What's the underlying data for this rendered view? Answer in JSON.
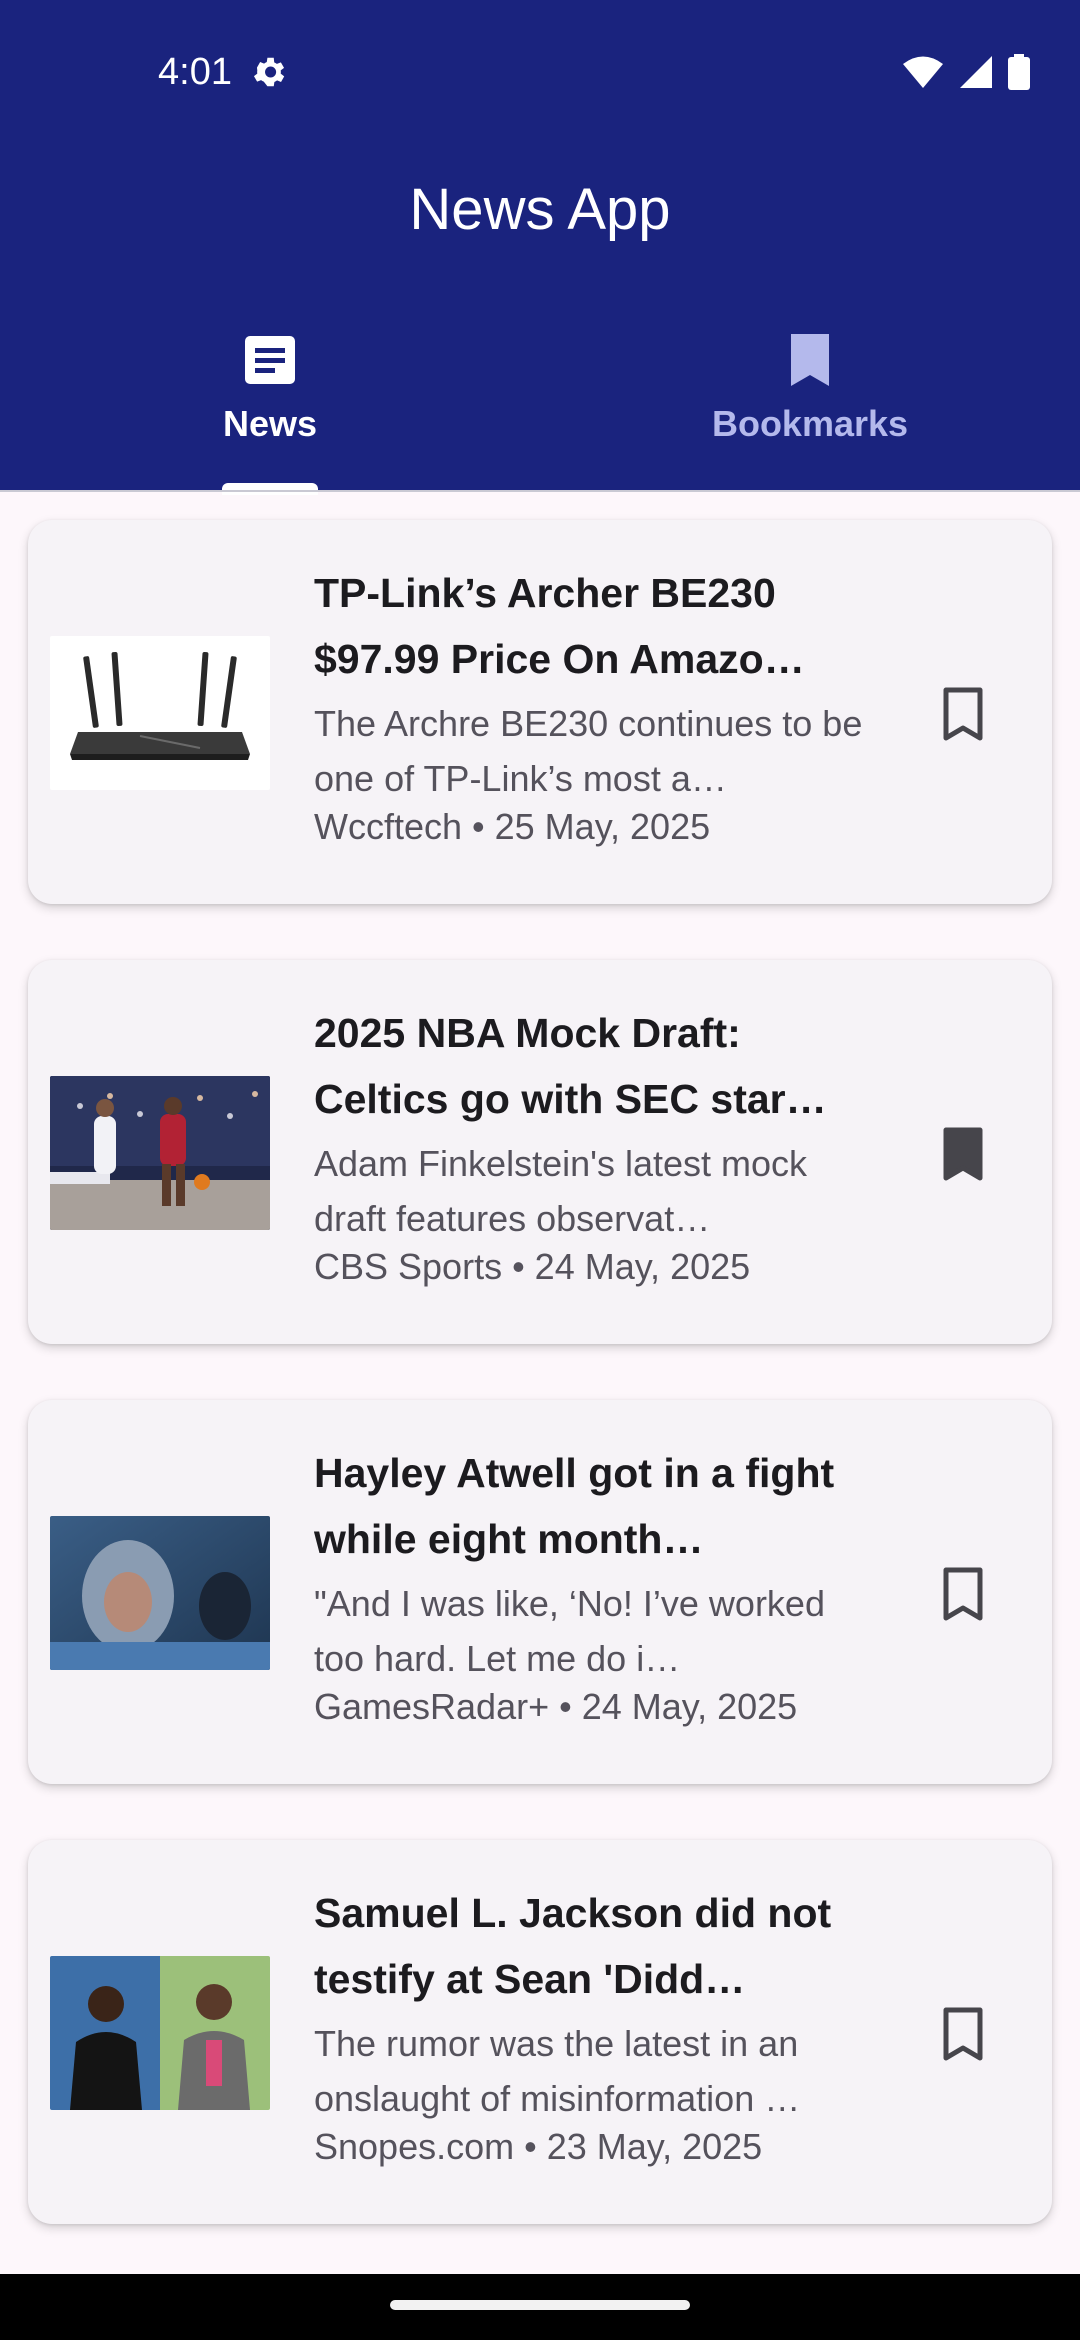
{
  "status_bar": {
    "time": "4:01",
    "icons": [
      "settings-gear-icon",
      "wifi-icon",
      "cellular-signal-icon",
      "battery-icon"
    ]
  },
  "app_bar": {
    "title": "News App",
    "background_color": "#1a237e"
  },
  "tabs": [
    {
      "label": "News",
      "icon": "article-icon",
      "selected": true
    },
    {
      "label": "Bookmarks",
      "icon": "bookmark-icon",
      "selected": false
    }
  ],
  "articles": [
    {
      "headline": "TP-Link’s Archer BE230 $97.99 Price On Amazo…",
      "description": "The Archre BE230 continues to be one of TP-Link’s most a…",
      "meta": "Wccftech • 25 May, 2025",
      "bookmarked": false,
      "thumbnail": "wifi-router-image"
    },
    {
      "headline": "2025 NBA Mock Draft: Celtics go with SEC star…",
      "description": "Adam Finkelstein's latest mock draft features observat…",
      "meta": "CBS Sports • 24 May, 2025",
      "bookmarked": true,
      "thumbnail": "basketball-game-image"
    },
    {
      "headline": "Hayley Atwell got in a fight while eight month…",
      "description": "\"And I was like, ‘No! I’ve worked too hard. Let me do i…",
      "meta": "GamesRadar+ • 24 May, 2025",
      "bookmarked": false,
      "thumbnail": "movie-still-image"
    },
    {
      "headline": "Samuel L. Jackson did not testify at Sean 'Didd…",
      "description": "The rumor was the latest in an onslaught of misinformation …",
      "meta": "Snopes.com • 23 May, 2025",
      "bookmarked": false,
      "thumbnail": "celebrity-photo-image"
    }
  ]
}
